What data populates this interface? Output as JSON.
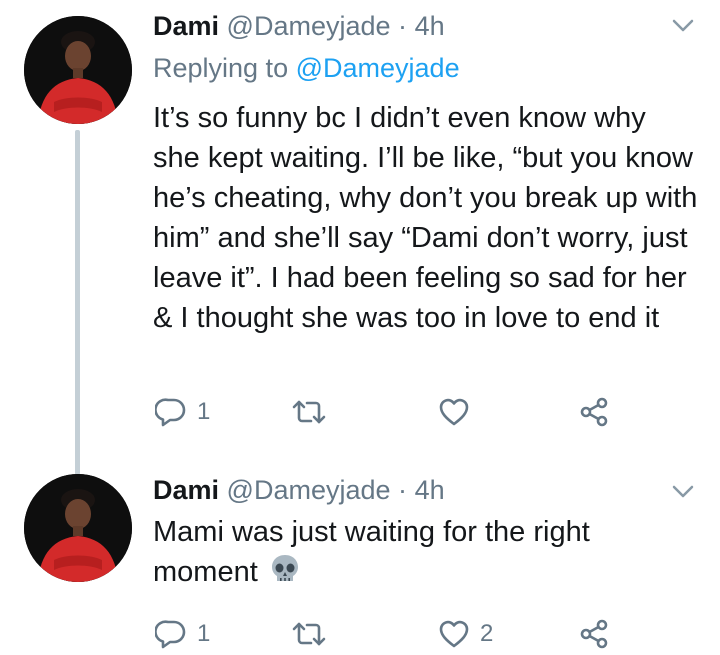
{
  "tweets": [
    {
      "name": "Dami",
      "handle": "@Dameyjade",
      "separator": "·",
      "time": "4h",
      "replying_prefix": "Replying to",
      "replying_to": "@Dameyjade",
      "text": "It’s so funny bc I didn’t even know why she kept waiting. I’ll be like, “but you know he’s cheating, why don’t you break up with him” and she’ll say “Dami don’t worry, just leave it”. I had been feeling so sad for her & I thought she was too in love to end it",
      "reply_count": "1",
      "retweet_count": "",
      "like_count": ""
    },
    {
      "name": "Dami",
      "handle": "@Dameyjade",
      "separator": "·",
      "time": "4h",
      "text": "Mami was just waiting for the right moment",
      "emoji": "skull-emoji",
      "reply_count": "1",
      "retweet_count": "",
      "like_count": "2"
    }
  ],
  "icons": {
    "reply": "reply-icon",
    "retweet": "retweet-icon",
    "like": "heart-icon",
    "share": "share-icon",
    "menu": "chevron-down-icon"
  },
  "colors": {
    "text": "#14171a",
    "secondary": "#657786",
    "mention": "#1da1f2",
    "thread_line": "#c4cfd6",
    "avatar_outfit": "#d32a2a"
  }
}
